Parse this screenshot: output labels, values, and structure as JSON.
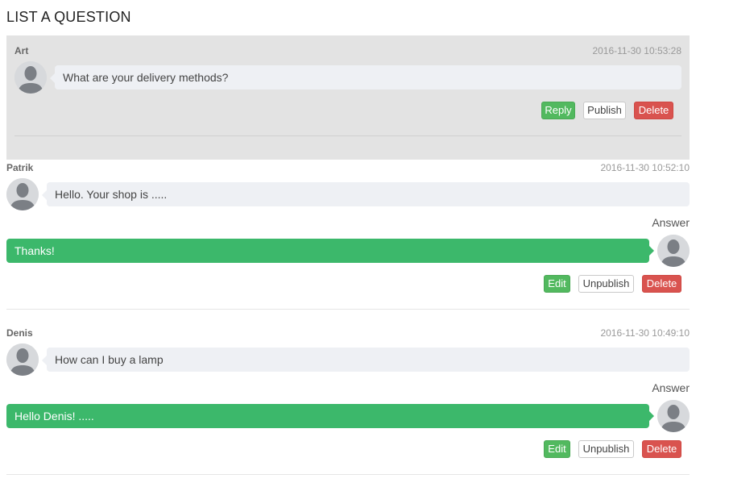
{
  "page": {
    "title": "LIST A QUESTION"
  },
  "questions": [
    {
      "author": "Art",
      "timestamp": "2016-11-30 10:53:28",
      "question": "What are your delivery methods?",
      "actions": {
        "reply": "Reply",
        "publish": "Publish",
        "delete": "Delete"
      }
    },
    {
      "author": "Patrik",
      "timestamp": "2016-11-30 10:52:10",
      "question": "Hello. Your shop is .....",
      "answer_label": "Answer",
      "answer": "Thanks!",
      "actions": {
        "edit": "Edit",
        "unpublish": "Unpublish",
        "delete": "Delete"
      }
    },
    {
      "author": "Denis",
      "timestamp": "2016-11-30 10:49:10",
      "question": "How can I buy a lamp",
      "answer_label": "Answer",
      "answer": "Hello Denis! .....",
      "actions": {
        "edit": "Edit",
        "unpublish": "Unpublish",
        "delete": "Delete"
      }
    }
  ],
  "colors": {
    "answer_bubble": "#3cb86b",
    "question_bubble": "#eef0f4",
    "active_block": "#e3e3e3",
    "delete_button": "#d9534f",
    "edit_button": "#52b95f"
  },
  "icons": {
    "avatar": "user-avatar-icon"
  }
}
